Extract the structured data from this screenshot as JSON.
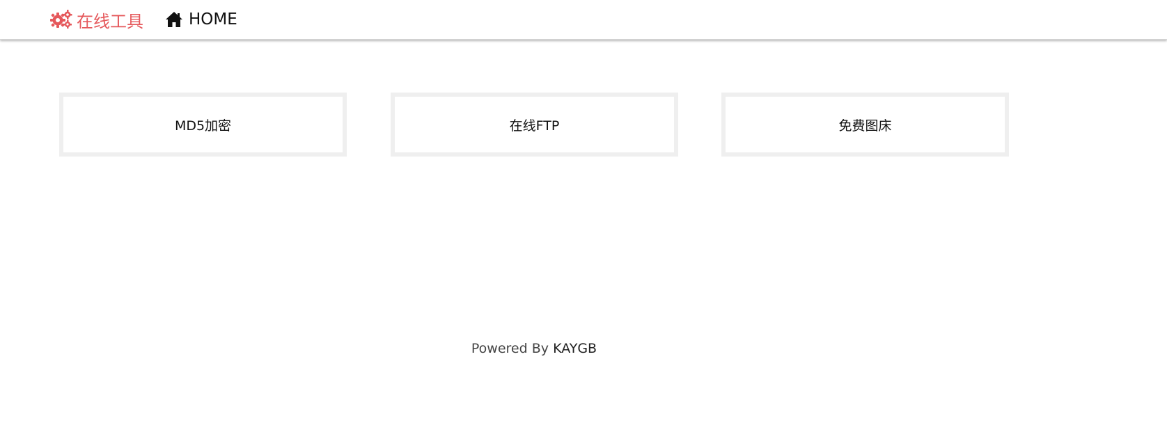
{
  "navbar": {
    "brand": {
      "label": "在线工具",
      "icon": "gears-icon",
      "color": "#e5585b"
    },
    "home": {
      "label": "HOME",
      "icon": "home-icon"
    }
  },
  "tools": [
    {
      "label": "MD5加密"
    },
    {
      "label": "在线FTP"
    },
    {
      "label": "免费图床"
    }
  ],
  "footer": {
    "prefix": "Powered By",
    "author": "KAYGB"
  },
  "colors": {
    "accent": "#e5585b",
    "card_border": "#efefef"
  }
}
